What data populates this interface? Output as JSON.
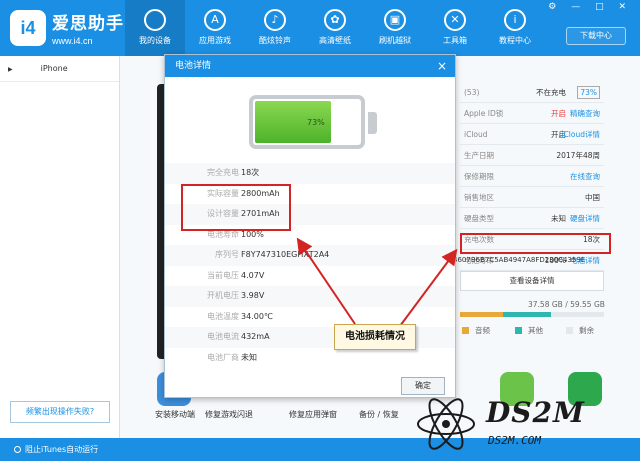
{
  "app": {
    "logo_text": "i4",
    "name": "爱思助手",
    "url": "www.i4.cn"
  },
  "nav": [
    {
      "label": "我的设备",
      "icon": "apple-icon",
      "glyph": ""
    },
    {
      "label": "应用游戏",
      "icon": "app-store-icon",
      "glyph": "A"
    },
    {
      "label": "酷炫铃声",
      "icon": "bell-icon",
      "glyph": "♪"
    },
    {
      "label": "高清壁纸",
      "icon": "flower-icon",
      "glyph": "✿"
    },
    {
      "label": "刷机越狱",
      "icon": "box-icon",
      "glyph": "▣"
    },
    {
      "label": "工具箱",
      "icon": "tools-icon",
      "glyph": "✕"
    },
    {
      "label": "教程中心",
      "icon": "info-icon",
      "glyph": "i"
    }
  ],
  "header": {
    "download_label": "下载中心",
    "window_controls": "⚙ — □ ✕"
  },
  "sidebar": {
    "device_name": "iPhone",
    "help_label": "频繁出现操作失败?"
  },
  "device_info": {
    "rows": [
      {
        "label": "(53)",
        "value": "不在充电",
        "link": "73%",
        "boxed": true
      },
      {
        "label": "Apple ID锁",
        "value": "开启",
        "link": "精确查询",
        "warn": true
      },
      {
        "label": "iCloud",
        "value": "开启",
        "link": "iCloud详情"
      },
      {
        "label": "生产日期",
        "value": "2017年48周",
        "link": ""
      },
      {
        "label": "保修期限",
        "value": "",
        "link": "在线查询"
      },
      {
        "label": "销售地区",
        "value": "中国",
        "link": ""
      },
      {
        "label": "硬盘类型",
        "value": "未知",
        "link": "硬盘详情"
      },
      {
        "label": "充电次数",
        "value": "18次",
        "link": ""
      },
      {
        "label": "电池寿命",
        "value": "100%",
        "link": "电池详情"
      }
    ],
    "serial_line": "4607B6B7C5AB4947A8FD230C4359E",
    "detail_button": "查看设备详情",
    "storage": "37.58 GB / 59.55 GB",
    "storage_fill": [
      {
        "pct": 0.3,
        "color": "#e8a93a"
      },
      {
        "pct": 0.33,
        "color": "#2fb6b0"
      }
    ],
    "legend": [
      {
        "label": "音频",
        "color": "#e8a93a"
      },
      {
        "label": "其他",
        "color": "#2fb6b0"
      },
      {
        "label": "剩余",
        "color": "#e3e8ec"
      }
    ]
  },
  "tools": [
    {
      "label": "安装移动端",
      "color": "#3c8fde"
    },
    {
      "label": "修复游戏闪退",
      "color": ""
    },
    {
      "label": "修复应用弹窗",
      "color": ""
    },
    {
      "label": "备份 / 恢复",
      "color": ""
    },
    {
      "label": "",
      "color": "#6cc34a"
    },
    {
      "label": "",
      "color": "#2ea84c"
    }
  ],
  "bottombar": {
    "itunes_label": "阻止iTunes自动运行"
  },
  "dialog": {
    "title": "电池详情",
    "battery_percent_text": "73%",
    "battery_level": 0.73,
    "rows": [
      {
        "key": "完全充电",
        "value": "18次"
      },
      {
        "key": "实际容量",
        "value": "2800mAh"
      },
      {
        "key": "设计容量",
        "value": "2701mAh"
      },
      {
        "key": "电池寿命",
        "value": "100%"
      },
      {
        "key": "序列号",
        "value": "F8Y747310EGHXT2A4"
      },
      {
        "key": "当前电压",
        "value": "4.07V"
      },
      {
        "key": "开机电压",
        "value": "3.98V"
      },
      {
        "key": "电池温度",
        "value": "34.00℃"
      },
      {
        "key": "电池电流",
        "value": "432mA"
      },
      {
        "key": "电池厂商",
        "value": "未知"
      }
    ],
    "ok_label": "确定"
  },
  "annotation": {
    "callout_text": "电池损耗情况",
    "color": "#d32323"
  },
  "watermark": {
    "big": "DS2M",
    "small": "DS2M.COM"
  }
}
